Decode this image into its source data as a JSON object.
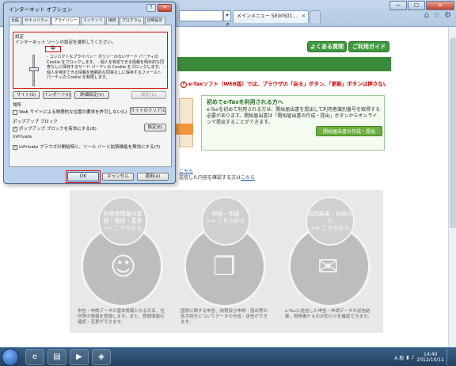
{
  "browser": {
    "address_text": "▾ ↺ ✕",
    "tab_title": "メインメニュー SE00501...",
    "tab_close": "✕",
    "window_buttons": {
      "minimize": "─",
      "maximize": "☐",
      "close": "✕"
    },
    "nav": {
      "faq": "よくある質問",
      "guide": "ご利用ガイド"
    }
  },
  "page": {
    "notice": "e-Taxソフト（WEB版）では、ブラウザの「戻る」ボタン、「更新」ボタンは押さないでください。",
    "first_time_title": "初めてe-Taxを利用される方へ",
    "first_time_body": "e-Taxを初めて利用される方は、開始届出書を提出して利用者識別番号を取得する必要があります。開始届出書は「開始届出書の作成・提出」ボタンからオンラインで提出することができます。",
    "first_time_button": "開始届出書の作成・提出",
    "link1": {
      "text": "こちら",
      "prefix": ""
    },
    "link2": {
      "prefix": "送信した内容を確認する方は",
      "text": "こちら"
    },
    "panel": [
      {
        "title": "利用者情報の登録・確認・変更",
        "sub": ">> こちらから",
        "desc": "申告・申請データの基本情報となる氏名、住所等の情報を登録します。また、登録情報の確認・変更ができます。"
      },
      {
        "title": "申告・申請",
        "sub": ">> こちらから",
        "desc": "国税に関する申告、納税及び申請・届出等の各手続きについてデータの作成・送信ができます。"
      },
      {
        "title": "送信結果・お知らせ",
        "sub": ">> こちらから",
        "desc": "e-Taxに送信した申告・申請データの送信結果、税務署からのお知らせを確認できます。"
      }
    ]
  },
  "dialog": {
    "title": "インターネット オプション",
    "help": "?",
    "close": "✕",
    "tabs": [
      "全般",
      "セキュリティ",
      "プライバシー",
      "コンテンツ",
      "接続",
      "プログラム",
      "詳細設定"
    ],
    "active_tab": "プライバシー",
    "settings_label": "設定",
    "zone_label": "インターネット ゾーンの設定を選択してください。",
    "level": "中",
    "level_desc": "- コンパクトなプライバシー ポリシーのないサード パーティの Cookie をブロックします。\n- 個人を特定できる情報を明示的な同意なしに保存するサード パーティの Cookie をブロックします。\n- 個人を特定できる情報を暗黙的な同意なしに保存するファースト パーティの Cookie を制限します。",
    "buttons": {
      "site": "サイト(S)",
      "import": "インポート(I)",
      "advanced": "詳細設定(V)",
      "default": "既定(D)",
      "clear_sites": "サイトのクリア(C)",
      "popup_settings": "設定(E)",
      "ok": "OK",
      "cancel": "キャンセル",
      "apply": "適用(A)"
    },
    "location_section": "場所",
    "location_check": "Web サイトによる物理的な位置の要求を許可しない(L)",
    "popup_section": "ポップアップ ブロック",
    "popup_check": "ポップアップ ブロックを有効にする(B)",
    "inprivate_section": "InPrivate",
    "inprivate_check": "InPrivate ブラウズの開始時に、ツール バーと拡張機能を無効にする(T)"
  },
  "taskbar": {
    "clock_time": "14:40",
    "clock_date": "2012/10/11",
    "lang": "A 般"
  },
  "colors": {
    "accent_green": "#3a8b3a",
    "highlight_red": "#cc1111"
  }
}
